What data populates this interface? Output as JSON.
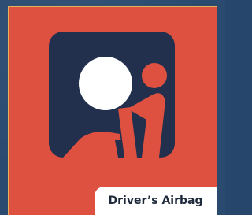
{
  "card": {
    "caption": "Driver’s Airbag",
    "icon": "airbag-icon"
  },
  "colors": {
    "page_background": "#2a4a70",
    "card_background": "#de5040",
    "card_border": "#e2b45a",
    "icon_background": "#22304d",
    "caption_background": "#ffffff",
    "caption_text": "#1e2a3c"
  }
}
